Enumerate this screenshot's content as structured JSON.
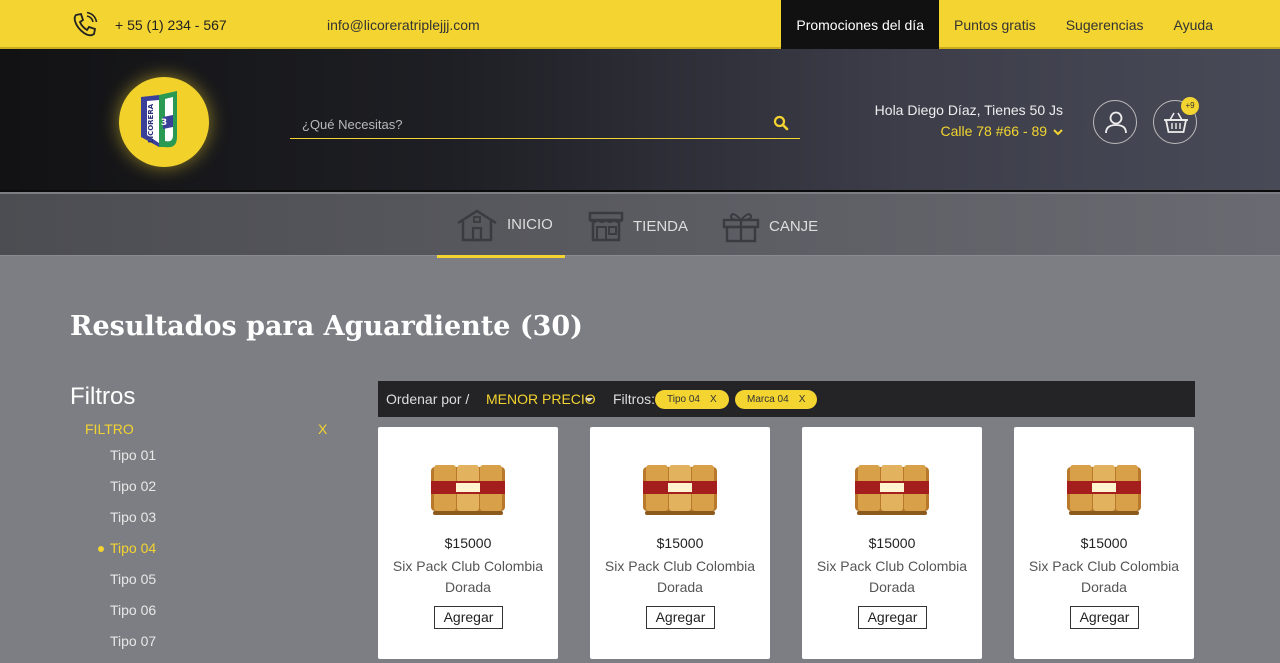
{
  "topbar": {
    "phone": "+ 55 (1) 234 - 567",
    "email": "info@licoreratriplejjj.com",
    "nav": [
      {
        "label": "Promociones del día",
        "active": true
      },
      {
        "label": "Puntos gratis",
        "active": false
      },
      {
        "label": "Sugerencias",
        "active": false
      },
      {
        "label": "Ayuda",
        "active": false
      }
    ]
  },
  "header": {
    "logo_text": "LICORERA 3 J",
    "search_placeholder": "¿Qué Necesitas?",
    "greeting": "Hola Diego Díaz, Tienes 50 Js",
    "address": "Calle 78 #66 - 89",
    "cart_count": "+9"
  },
  "nav": {
    "items": [
      {
        "label": "INICIO",
        "icon": "home-icon",
        "active": true
      },
      {
        "label": "TIENDA",
        "icon": "store-icon",
        "active": false
      },
      {
        "label": "CANJE",
        "icon": "gift-icon",
        "active": false
      }
    ]
  },
  "main": {
    "results_title": "Resultados para Aguardiente (30)"
  },
  "filters": {
    "title": "Filtros",
    "header": "FILTRO",
    "clear": "X",
    "types": [
      "Tipo 01",
      "Tipo 02",
      "Tipo 03",
      "Tipo 04",
      "Tipo 05",
      "Tipo 06",
      "Tipo 07"
    ],
    "active_type": "Tipo 04"
  },
  "sortbar": {
    "label": "Ordenar por /",
    "value": "MENOR PRECIO",
    "filters_label": "Filtros:",
    "chips": [
      {
        "label": "Tipo 04",
        "remove": "X"
      },
      {
        "label": "Marca 04",
        "remove": "X"
      }
    ]
  },
  "products": [
    {
      "price": "$15000",
      "name": "Six Pack Club Colombia Dorada",
      "button": "Agregar"
    },
    {
      "price": "$15000",
      "name": "Six Pack Club Colombia Dorada",
      "button": "Agregar"
    },
    {
      "price": "$15000",
      "name": "Six Pack Club Colombia Dorada",
      "button": "Agregar"
    },
    {
      "price": "$15000",
      "name": "Six Pack Club Colombia Dorada",
      "button": "Agregar"
    }
  ],
  "colors": {
    "accent": "#f3d430",
    "dark": "#1e1f24",
    "background": "#7d7e83"
  }
}
